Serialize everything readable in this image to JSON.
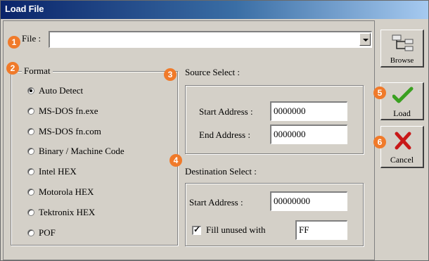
{
  "window": {
    "title": "Load File"
  },
  "file": {
    "label": "File :",
    "value": ""
  },
  "format": {
    "title": "Format",
    "options": [
      {
        "label": "Auto Detect",
        "selected": true
      },
      {
        "label": "MS-DOS fn.exe",
        "selected": false
      },
      {
        "label": "MS-DOS fn.com",
        "selected": false
      },
      {
        "label": "Binary / Machine Code",
        "selected": false
      },
      {
        "label": "Intel  HEX",
        "selected": false
      },
      {
        "label": "Motorola HEX",
        "selected": false
      },
      {
        "label": "Tektronix HEX",
        "selected": false
      },
      {
        "label": "POF",
        "selected": false
      }
    ]
  },
  "source": {
    "title": "Source Select :",
    "start_label": "Start Address :",
    "start_value": "0000000",
    "end_label": "End Address :",
    "end_value": "0000000"
  },
  "destination": {
    "title": "Destination Select :",
    "start_label": "Start Address :",
    "start_value": "00000000",
    "fill_label": "Fill unused with",
    "fill_checked": true,
    "fill_value": "FF"
  },
  "buttons": {
    "browse": "Browse",
    "load": "Load",
    "cancel": "Cancel"
  },
  "callouts": [
    "1",
    "2",
    "3",
    "4",
    "5",
    "6"
  ],
  "colors": {
    "callout": "#f07a2a",
    "title_bar": "#0a246a",
    "dialog_bg": "#d4d0c8",
    "load_check": "#3aa020",
    "cancel_x": "#c81818"
  }
}
